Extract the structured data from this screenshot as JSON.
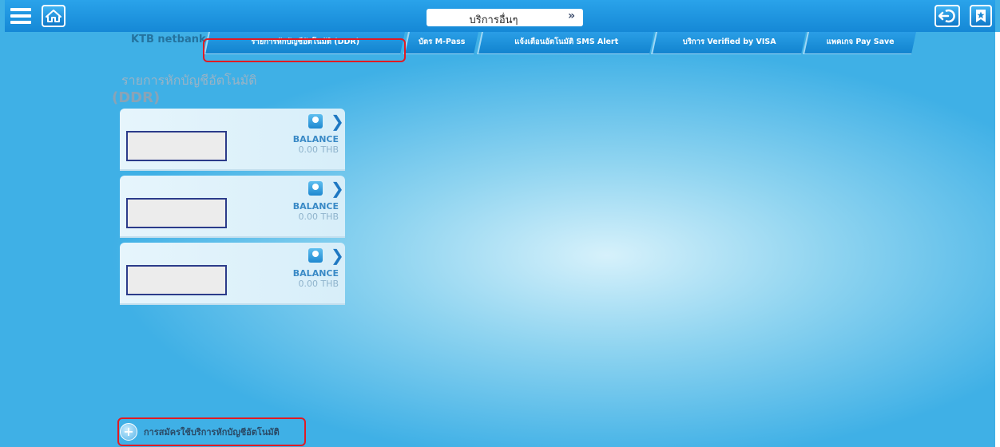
{
  "topbar": {
    "menu_icon": "hamburger-icon",
    "home_icon": "home-icon",
    "service_select": {
      "selected": "บริการอื่นๆ",
      "icon": "double-chevron-down-icon"
    },
    "back_icon": "logout-arrow-icon",
    "favorite_icon": "bookmark-star-icon"
  },
  "tabstrip": {
    "brand": "KTB netbank",
    "tabs": [
      {
        "label": "รายการหักบัญชีอัตโนมัติ (DDR)",
        "active": true
      },
      {
        "label": "บัตร M-Pass"
      },
      {
        "label": "แจ้งเตือนอัตโนมัติ SMS Alert"
      },
      {
        "label": "บริการ Verified by VISA"
      },
      {
        "label": "แพคเกจ Pay Save"
      }
    ]
  },
  "page": {
    "title_line1": "รายการหักบัญชีอัตโนมัติ",
    "title_line2": "(DDR)"
  },
  "accounts": [
    {
      "balance_label": "BALANCE",
      "balance_value": "0.00 THB",
      "bank_icon": "ktb-bank-icon"
    },
    {
      "balance_label": "BALANCE",
      "balance_value": "0.00 THB",
      "bank_icon": "ktb-bank-icon"
    },
    {
      "balance_label": "BALANCE",
      "balance_value": "0.00 THB",
      "bank_icon": "ktb-bank-icon"
    }
  ],
  "register": {
    "label": "การสมัครใช้บริการหักบัญชีอัตโนมัติ",
    "icon": "plus-circle-icon"
  },
  "colors": {
    "topbar": "#1a8fdc",
    "highlight": "#e01b24",
    "balance_label": "#3a8ac6"
  }
}
